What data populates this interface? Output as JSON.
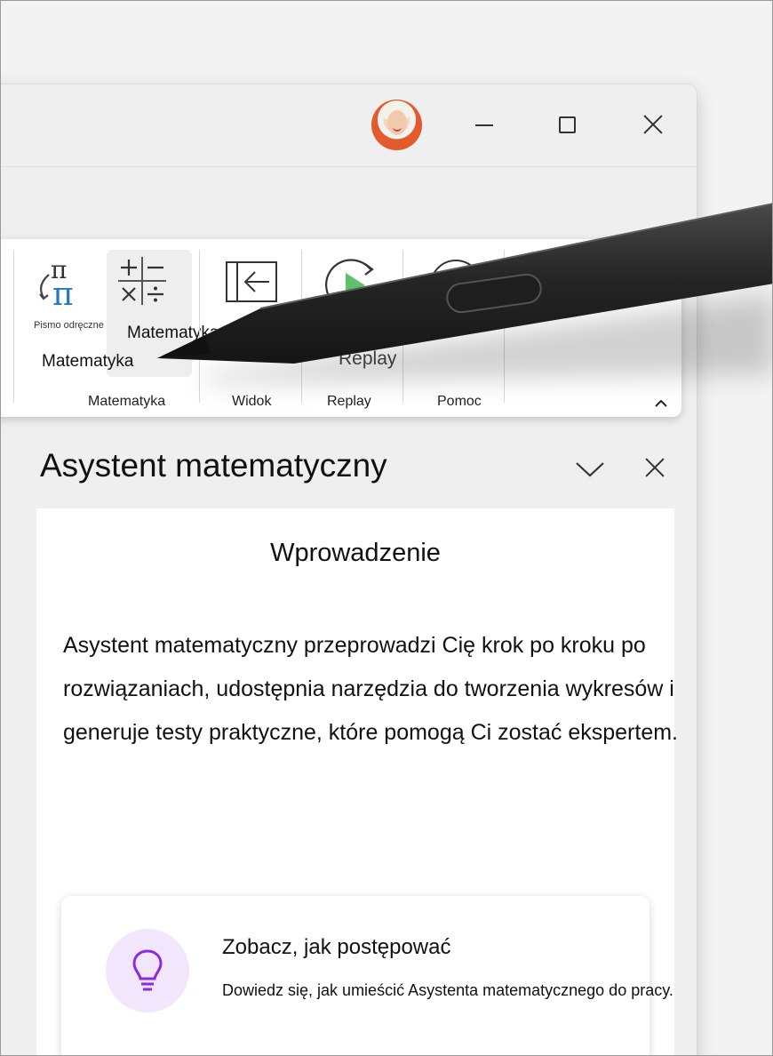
{
  "ribbon": {
    "ink_math": {
      "small_label": "Pismo odręczne na",
      "label": "Matematyka"
    },
    "math": {
      "label": "Matematyka"
    },
    "groups": [
      {
        "label": "Matematyka"
      },
      {
        "label": "Widok"
      },
      {
        "label": "Replay"
      },
      {
        "label": "Pomoc"
      }
    ],
    "replay_button": {
      "label": "Replay"
    }
  },
  "pane": {
    "title": "Asystent matematyczny",
    "intro_heading": "Wprowadzenie",
    "intro_text": "Asystent matematyczny przeprowadzi Cię krok po kroku po rozwiązaniach, udostępnia narzędzia do tworzenia wykresów i generuje testy praktyczne, które pomogą Ci zostać ekspertem.",
    "tip": {
      "title": "Zobacz, jak postępować",
      "description": "Dowiedz się, jak umieścić Asystenta matematycznego do pracy."
    }
  },
  "icons": {
    "ink_math": "pi-icon",
    "math": "math-operators-icon",
    "view": "arrow-left-panel-icon",
    "replay": "replay-icon",
    "help": "help-circle-icon",
    "tip": "lightbulb-icon",
    "collapse": "chevron-up-icon",
    "pane_menu": "chevron-down-icon",
    "pane_close": "close-icon",
    "avatar": "user-avatar"
  },
  "colors": {
    "accent": "#8a2be2",
    "pen": "#1e1e1e",
    "replay_green": "#5ec26a"
  }
}
